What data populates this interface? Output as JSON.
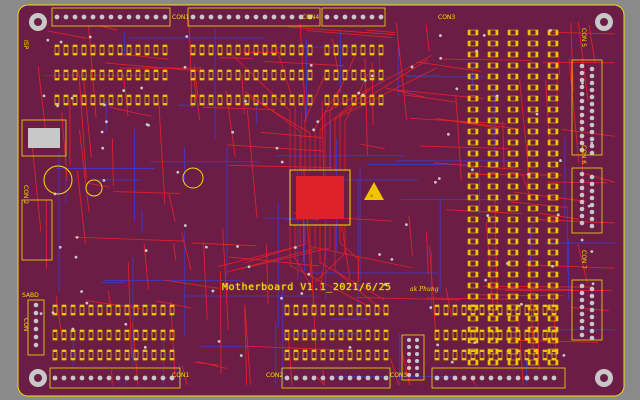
{
  "board": {
    "title": "Motherboard V1.1_2021/6/25",
    "author": "ak Phung",
    "colors": {
      "background": "#8a8a8a",
      "board": "#6b1d45",
      "top_copper": "#e0202a",
      "bottom_copper": "#3b3bd6",
      "silkscreen": "#f2e000",
      "pad": "#c8c8c8",
      "esd": "#f2c300"
    },
    "connector_labels": {
      "top_1": "CON1",
      "top_2": "CON4",
      "top_3": "CON3",
      "bottom_1": "CON1",
      "bottom_2": "CON2",
      "bottom_3": "CON3",
      "right_1": "CON 5",
      "right_2": "CON 6",
      "right_3": "CON 7",
      "left_1": "ISP",
      "left_2": "CON 2",
      "left_3": "SABD",
      "left_4": "CON"
    },
    "esd_icon": "esd-warning-icon",
    "mcu_icon": "qfp-chip-icon"
  }
}
